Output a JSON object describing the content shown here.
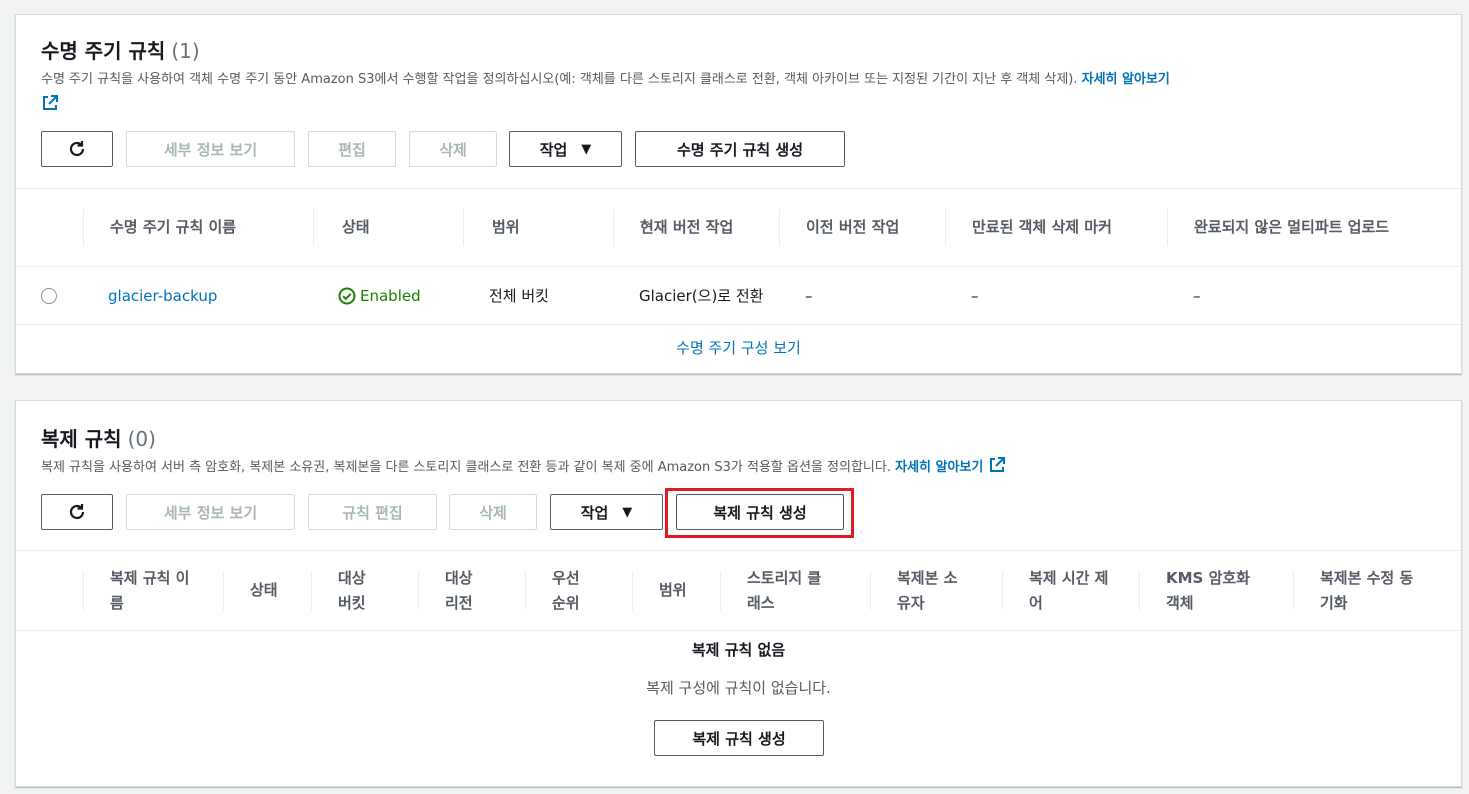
{
  "lifecycle": {
    "title": "수명 주기 규칙",
    "count": "(1)",
    "description": "수명 주기 규칙을 사용하여 객체 수명 주기 동안 Amazon S3에서 수행할 작업을 정의하십시오(예: 객체를 다른 스토리지 클래스로 전환, 객체 아카이브 또는 지정된 기간이 지난 후 객체 삭제).",
    "learn_more": "자세히 알아보기",
    "toolbar": {
      "view_details": "세부 정보 보기",
      "edit": "편집",
      "delete": "삭제",
      "actions": "작업",
      "create": "수명 주기 규칙 생성"
    },
    "columns": [
      "수명 주기 규칙 이름",
      "상태",
      "범위",
      "현재 버전 작업",
      "이전 버전 작업",
      "만료된 객체 삭제 마커",
      "완료되지 않은 멀티파트 업로드"
    ],
    "rows": [
      {
        "name": "glacier-backup",
        "status": "Enabled",
        "scope": "전체 버킷",
        "current_action": "Glacier(으)로 전환",
        "previous_action": "–",
        "expired_marker": "–",
        "incomplete_upload": "–"
      }
    ],
    "footer_link": "수명 주기 구성 보기"
  },
  "replication": {
    "title": "복제 규칙",
    "count": "(0)",
    "description": "복제 규칙을 사용하여 서버 측 암호화, 복제본 소유권, 복제본을 다른 스토리지 클래스로 전환 등과 같이 복제 중에 Amazon S3가 적용할 옵션을 정의합니다.",
    "learn_more": "자세히 알아보기",
    "toolbar": {
      "view_details": "세부 정보 보기",
      "edit": "규칙 편집",
      "delete": "삭제",
      "actions": "작업",
      "create": "복제 규칙 생성"
    },
    "columns": [
      "복제 규칙 이름",
      "상태",
      "대상 버킷",
      "대상 리전",
      "우선 순위",
      "범위",
      "스토리지 클래스",
      "복제본 소유자",
      "복제 시간 제어",
      "KMS 암호화 객체",
      "복제본 수정 동기화"
    ],
    "empty_title": "복제 규칙 없음",
    "empty_desc": "복제 구성에 규칙이 없습니다.",
    "empty_create": "복제 규칙 생성"
  },
  "colors": {
    "link": "#0073bb",
    "success": "#1d8102",
    "highlight": "#e21b23"
  },
  "icons": [
    "refresh-icon",
    "external-link-icon",
    "caret-down-icon",
    "check-circle-icon"
  ]
}
